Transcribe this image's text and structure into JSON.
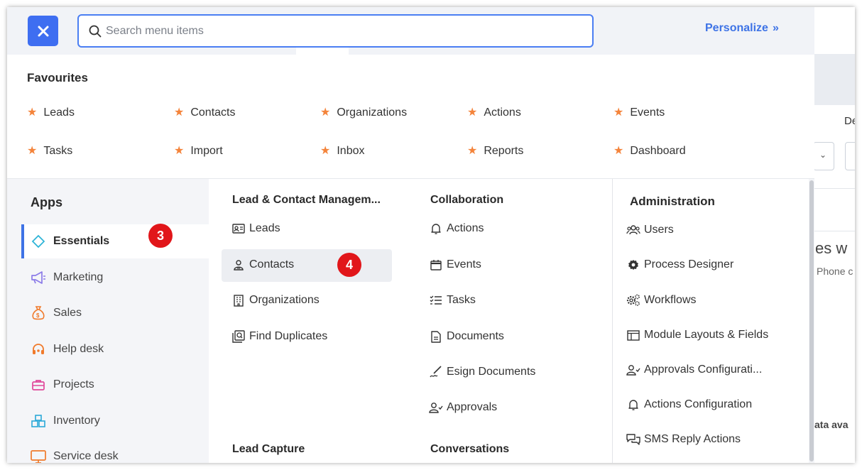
{
  "header": {
    "close_icon": "close-icon",
    "search_placeholder": "Search menu items",
    "personalize_label": "Personalize",
    "personalize_chevron": "»"
  },
  "favourites": {
    "title": "Favourites",
    "items": [
      "Leads",
      "Contacts",
      "Organizations",
      "Actions",
      "Events",
      "Tasks",
      "Import",
      "Inbox",
      "Reports",
      "Dashboard"
    ]
  },
  "apps": {
    "title": "Apps",
    "items": [
      {
        "label": "Essentials",
        "icon": "diamond-icon"
      },
      {
        "label": "Marketing",
        "icon": "megaphone-icon"
      },
      {
        "label": "Sales",
        "icon": "money-bag-icon"
      },
      {
        "label": "Help desk",
        "icon": "headset-icon"
      },
      {
        "label": "Projects",
        "icon": "briefcase-icon"
      },
      {
        "label": "Inventory",
        "icon": "boxes-icon"
      },
      {
        "label": "Service desk",
        "icon": "monitor-icon"
      }
    ],
    "active": "Essentials"
  },
  "badges": {
    "essentials": "3",
    "contacts": "4"
  },
  "columns": {
    "lead_contact": {
      "title": "Lead & Contact Managem...",
      "items": [
        "Leads",
        "Contacts",
        "Organizations",
        "Find Duplicates"
      ],
      "section2_title": "Lead Capture"
    },
    "collaboration": {
      "title": "Collaboration",
      "items": [
        "Actions",
        "Events",
        "Tasks",
        "Documents",
        "Esign Documents",
        "Approvals"
      ],
      "section2_title": "Conversations"
    },
    "administration": {
      "title": "Administration",
      "items": [
        "Users",
        "Process Designer",
        "Workflows",
        "Module Layouts & Fields",
        "Approvals Configurati...",
        "Actions Configuration",
        "SMS Reply Actions"
      ]
    }
  },
  "background": {
    "label_de": "De",
    "text_line1": "ties w",
    "text_line2": "Phone c",
    "text_line3": "ata ava"
  },
  "colors": {
    "accent": "#3e73e6",
    "close_button": "#3e6ef1",
    "star": "#f4843b",
    "badge": "#e1161a"
  }
}
